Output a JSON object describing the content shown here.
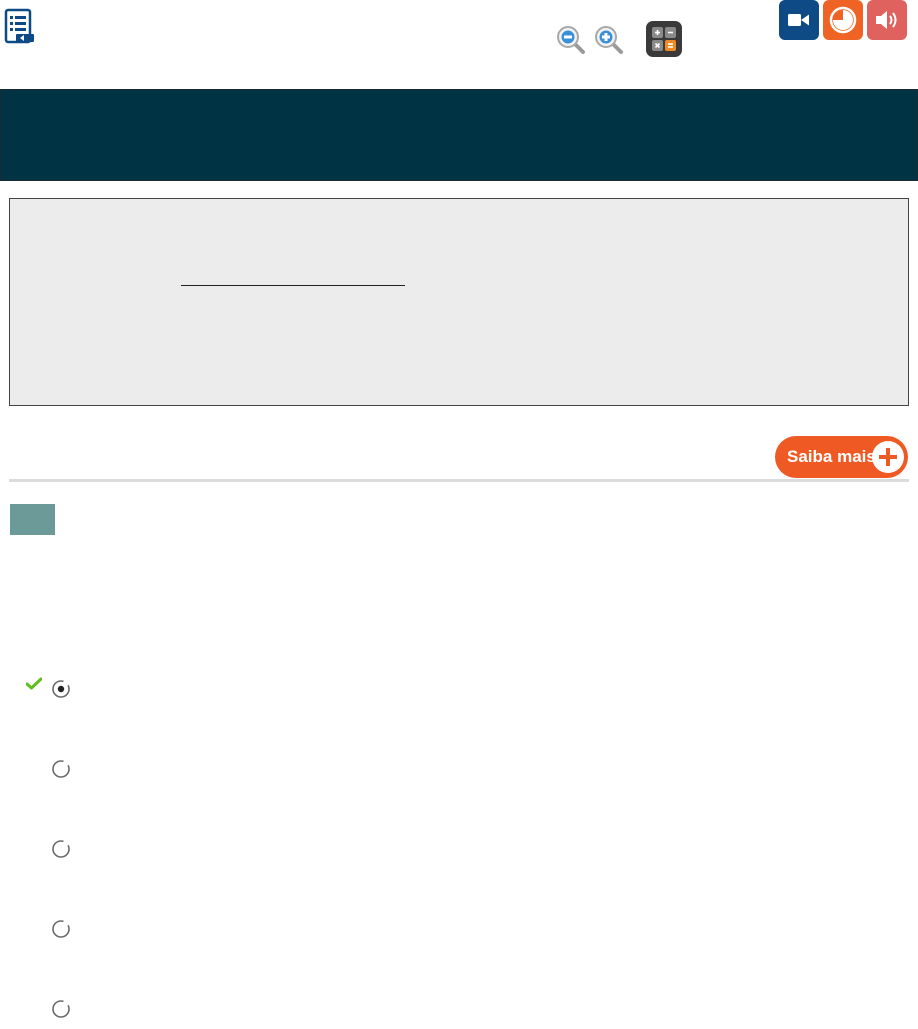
{
  "toolbar": {
    "icons": [
      "document-list-icon",
      "zoom-out-icon",
      "zoom-in-icon",
      "calculator-icon"
    ],
    "media_buttons": [
      "video-icon",
      "chart-icon",
      "audio-icon"
    ],
    "colors": {
      "video": "#0d4a86",
      "chart": "#ef6424",
      "audio": "#e0625f"
    }
  },
  "header": {
    "color": "#003444"
  },
  "statement": {
    "background": "#ececec"
  },
  "saiba_mais": {
    "label": "Saiba mais",
    "color": "#ef5a24"
  },
  "question": {
    "tag_color": "#6b9a99"
  },
  "options": [
    {
      "selected": true,
      "correct": true
    },
    {
      "selected": false
    },
    {
      "selected": false
    },
    {
      "selected": false
    },
    {
      "selected": false
    }
  ]
}
